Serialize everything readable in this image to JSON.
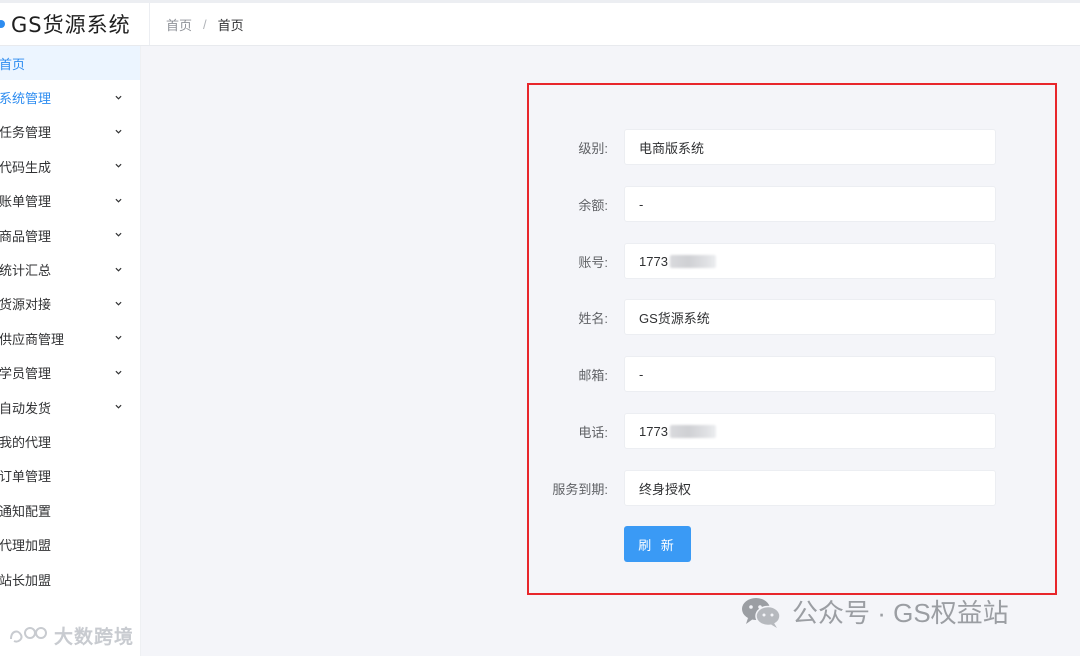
{
  "app": {
    "title": "GS货源系统"
  },
  "breadcrumb": {
    "home": "首页",
    "separator": "/",
    "current": "首页"
  },
  "sidebar": {
    "items": [
      {
        "label": "首页",
        "has_children": false,
        "active": true
      },
      {
        "label": "系统管理",
        "has_children": true,
        "active_parent": true
      },
      {
        "label": "任务管理",
        "has_children": true
      },
      {
        "label": "代码生成",
        "has_children": true
      },
      {
        "label": "账单管理",
        "has_children": true
      },
      {
        "label": "商品管理",
        "has_children": true
      },
      {
        "label": "统计汇总",
        "has_children": true
      },
      {
        "label": "货源对接",
        "has_children": true
      },
      {
        "label": "供应商管理",
        "has_children": true
      },
      {
        "label": "学员管理",
        "has_children": true
      },
      {
        "label": "自动发货",
        "has_children": true
      },
      {
        "label": "我的代理",
        "has_children": false
      },
      {
        "label": "订单管理",
        "has_children": false
      },
      {
        "label": "通知配置",
        "has_children": false
      },
      {
        "label": "代理加盟",
        "has_children": false
      },
      {
        "label": "站长加盟",
        "has_children": false
      }
    ]
  },
  "form": {
    "fields": [
      {
        "label": "级别:",
        "value": "电商版系统"
      },
      {
        "label": "余额:",
        "value": "-"
      },
      {
        "label": "账号:",
        "value": "1773",
        "redacted": true
      },
      {
        "label": "姓名:",
        "value": "GS货源系统"
      },
      {
        "label": "邮箱:",
        "value": "-"
      },
      {
        "label": "电话:",
        "value": "1773",
        "redacted": true
      },
      {
        "label": "服务到期:",
        "value": "终身授权"
      }
    ],
    "refresh_label": "刷 新"
  },
  "watermarks": {
    "left": "大数跨境",
    "right": "公众号 · GS权益站"
  },
  "colors": {
    "accent": "#2d8cf0",
    "button": "#3a9af5",
    "highlight_border": "#e8262b"
  }
}
